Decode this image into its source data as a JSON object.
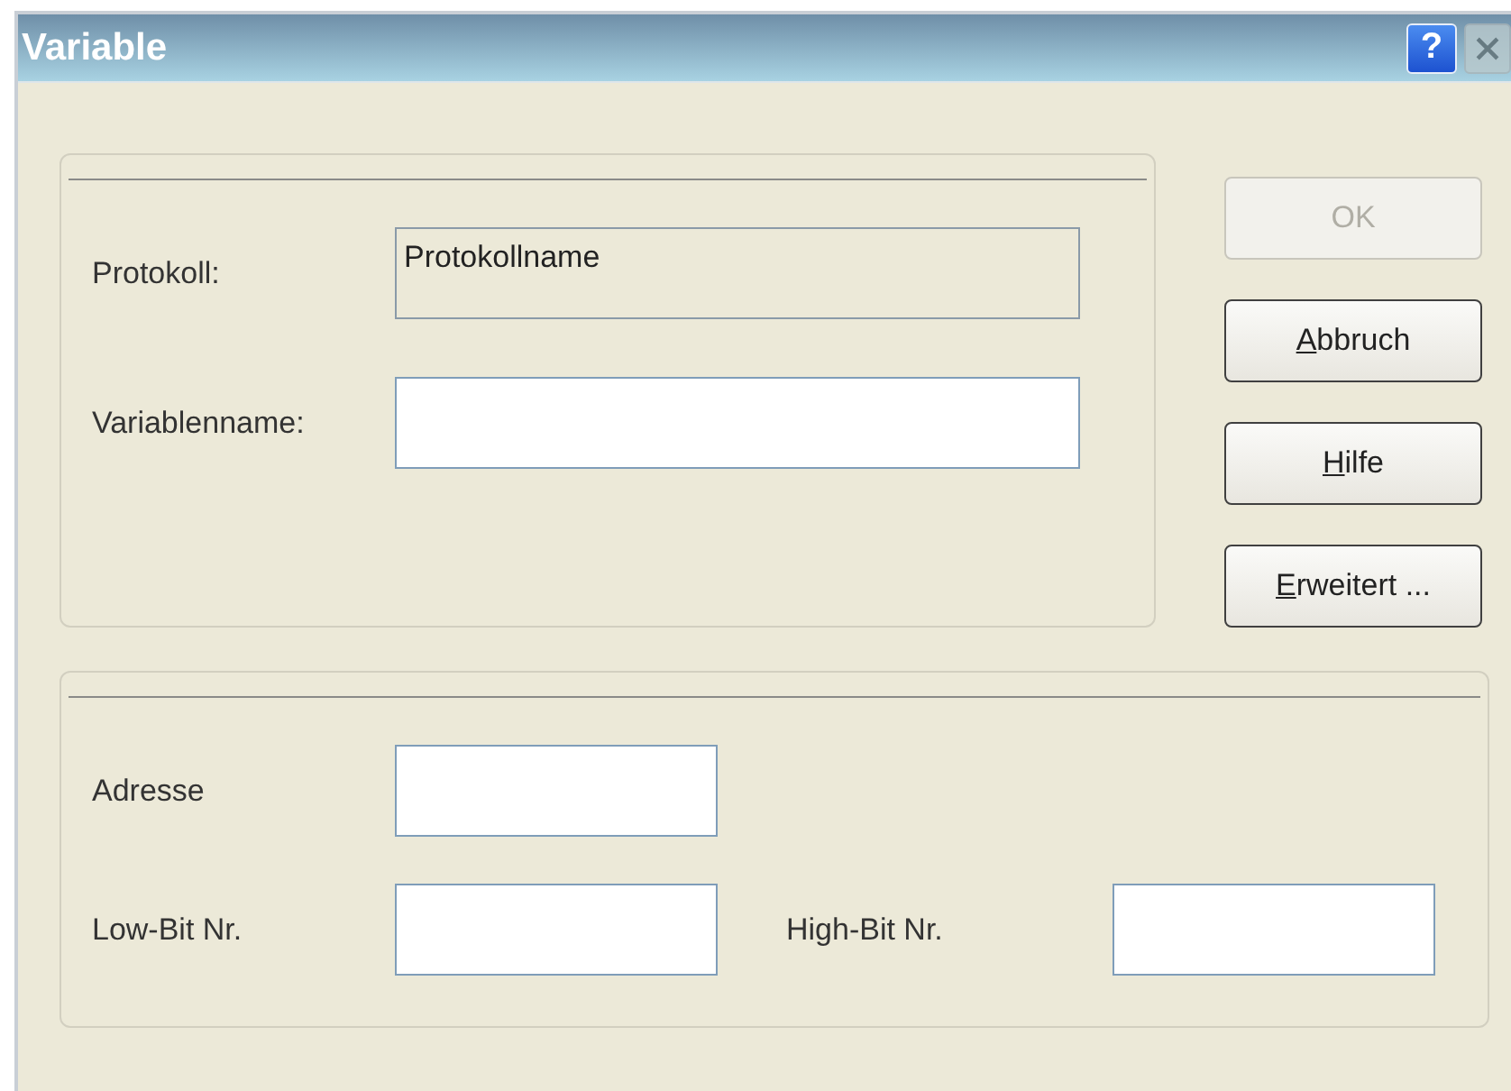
{
  "window": {
    "title": "Variable",
    "help_button": "?",
    "close_disabled": true
  },
  "main_group": {
    "rows": [
      {
        "label": "Protokoll:",
        "value": "Protokollname",
        "readonly": true
      },
      {
        "label": "Variablenname:",
        "readonly": false
      }
    ]
  },
  "buttons": [
    {
      "label": "OK",
      "first_letter_underlined": false,
      "disabled": true
    },
    {
      "label": "Abbruch",
      "first_letter_underlined": true,
      "disabled": false
    },
    {
      "label": "Hilfe",
      "first_letter_underlined": true,
      "disabled": false
    },
    {
      "label": "Erweitert ...",
      "first_letter_underlined": true,
      "disabled": false
    }
  ],
  "address_group": {
    "address": {
      "label": "Adresse"
    },
    "low_bit": {
      "label": "Low-Bit Nr."
    },
    "high_bit": {
      "label": "High-Bit Nr."
    }
  }
}
